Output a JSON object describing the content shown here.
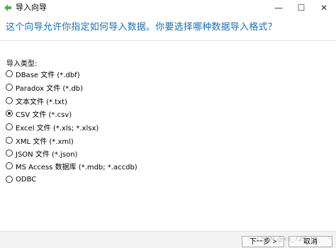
{
  "window": {
    "title": "导入向导",
    "minimize_glyph": "—",
    "maximize_glyph": "☐",
    "close_glyph": "✕"
  },
  "heading": "这个向导允许你指定如何导入数据。你要选择哪种数据导入格式？",
  "import_type": {
    "label": "导入类型:",
    "options": [
      {
        "label": "DBase 文件 (*.dbf)",
        "checked": false
      },
      {
        "label": "Paradox 文件 (*.db)",
        "checked": false
      },
      {
        "label": "文本文件 (*.txt)",
        "checked": false
      },
      {
        "label": "CSV 文件 (*.csv)",
        "checked": true
      },
      {
        "label": "Excel 文件 (*.xls; *.xlsx)",
        "checked": false
      },
      {
        "label": "XML 文件 (*.xml)",
        "checked": false
      },
      {
        "label": "JSON 文件 (*.json)",
        "checked": false
      },
      {
        "label": "MS Access 数据库 (*.mdb; *.accdb)",
        "checked": false
      },
      {
        "label": "ODBC",
        "checked": false
      }
    ]
  },
  "footer": {
    "next_label": "下一步 >",
    "cancel_label": "取消",
    "watermark": "CSDN @xu_729..."
  },
  "colors": {
    "heading": "#1a6fb5",
    "icon": "#4caf50"
  }
}
